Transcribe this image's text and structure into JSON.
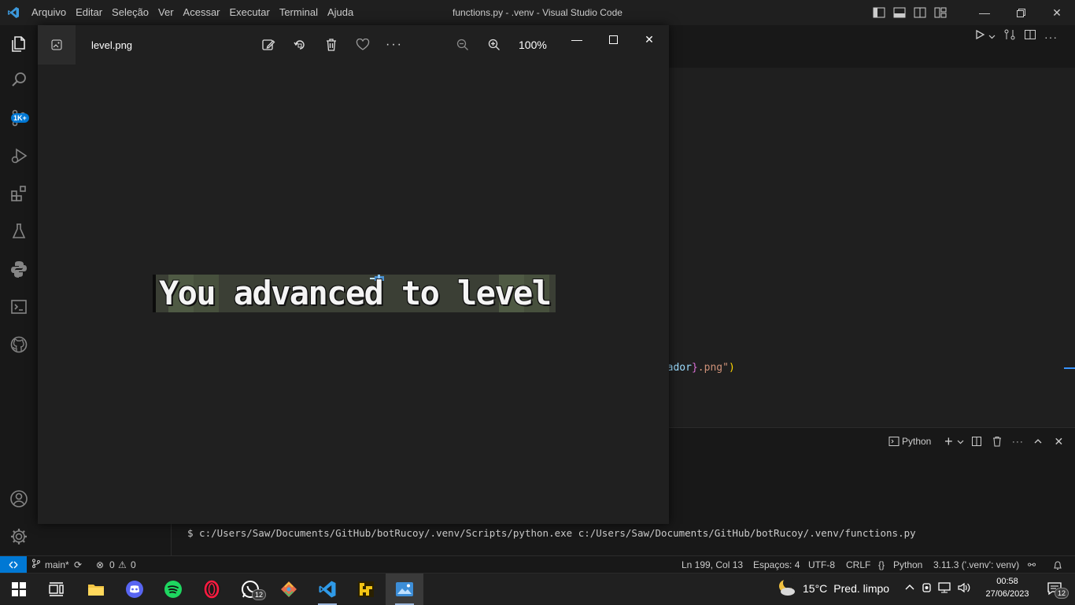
{
  "vscode": {
    "window_title": "functions.py - .venv - Visual Studio Code",
    "menu": [
      "Arquivo",
      "Editar",
      "Seleção",
      "Ver",
      "Acessar",
      "Executar",
      "Terminal",
      "Ajuda"
    ],
    "activity_badge": "1K+",
    "code_fragment": {
      "var": "ntador",
      "close": "}",
      "tail": ".png\"",
      "paren": ")"
    },
    "panel": {
      "terminal_type": "Python"
    },
    "terminal": {
      "command": "$ c:/Users/Saw/Documents/GitHub/botRucoy/.venv/Scripts/python.exe c:/Users/Saw/Documents/GitHub/botRucoy/.venv/functions.py"
    },
    "statusbar": {
      "branch": "main*",
      "errors": "0",
      "warnings": "0",
      "cursor": "Ln 199, Col 13",
      "spaces": "Espaços: 4",
      "encoding": "UTF-8",
      "eol": "CRLF",
      "language": "Python",
      "interpreter": "3.11.3 ('.venv': venv)"
    }
  },
  "photos": {
    "file_name": "level.png",
    "zoom": "100%",
    "image_text": "You advanced to level"
  },
  "taskbar": {
    "whatsapp_badge": "12",
    "weather_temp": "15°C",
    "weather_desc": "Pred. limpo",
    "time": "00:58",
    "date": "27/06/2023",
    "notification_count": "12"
  },
  "colors": {
    "accent": "#0078d4",
    "panel_bg": "#181818",
    "editor_bg": "#1f1f1f",
    "photos_bg": "#202020"
  }
}
